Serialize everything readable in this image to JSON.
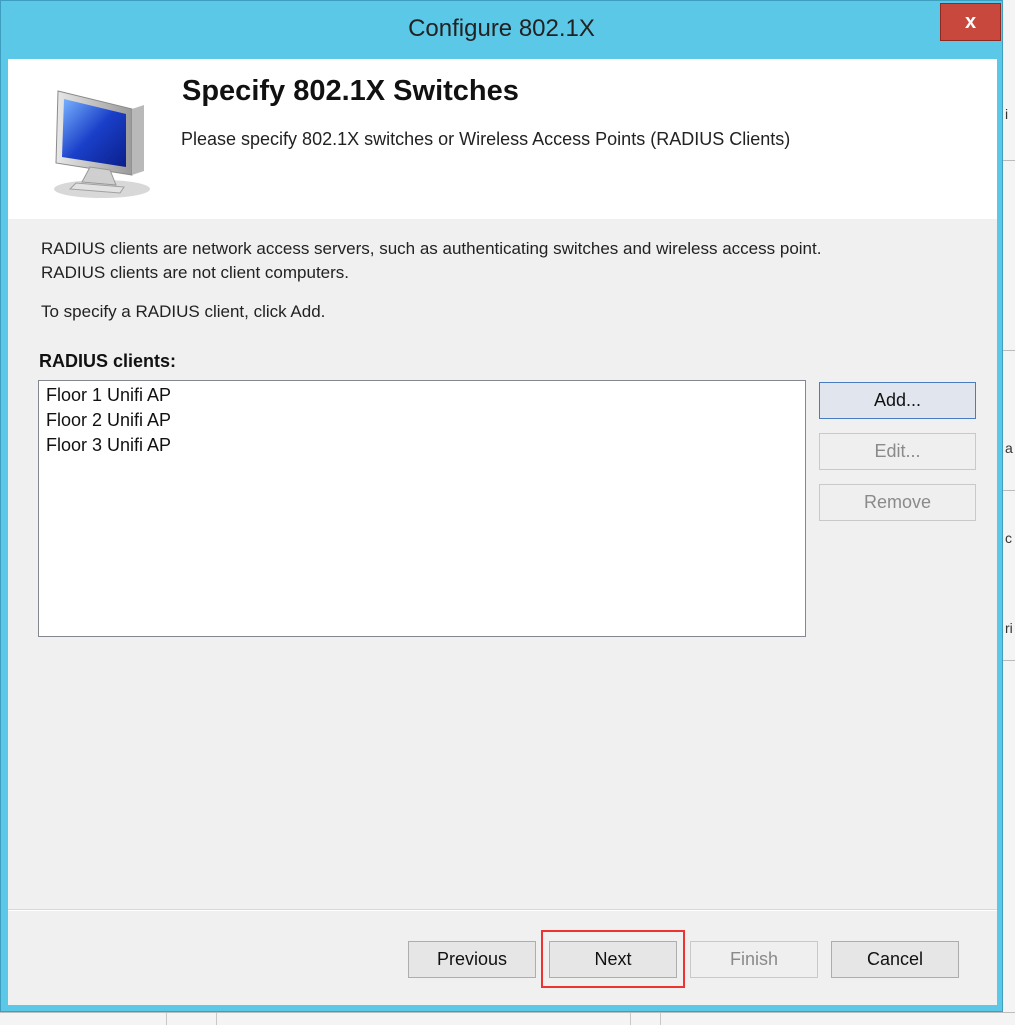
{
  "window": {
    "title": "Configure 802.1X",
    "close_label": "x"
  },
  "header": {
    "title": "Specify 802.1X Switches",
    "subtitle": "Please specify 802.1X switches or Wireless Access Points (RADIUS Clients)",
    "icon": "computer-monitor-icon"
  },
  "body": {
    "desc_line1": "RADIUS clients are network access servers, such as authenticating switches and wireless access point.",
    "desc_line2": "RADIUS clients are not client computers.",
    "instruction": "To specify a RADIUS client, click Add.",
    "list_label": "RADIUS clients:",
    "clients": [
      "Floor 1 Unifi AP",
      "Floor 2 Unifi AP",
      "Floor 3 Unifi AP"
    ]
  },
  "side_buttons": {
    "add": "Add...",
    "edit": "Edit...",
    "remove": "Remove"
  },
  "footer_buttons": {
    "previous": "Previous",
    "next": "Next",
    "finish": "Finish",
    "cancel": "Cancel"
  },
  "colors": {
    "titlebar": "#5bc8e8",
    "close": "#c9483d",
    "highlight": "#e33333"
  }
}
